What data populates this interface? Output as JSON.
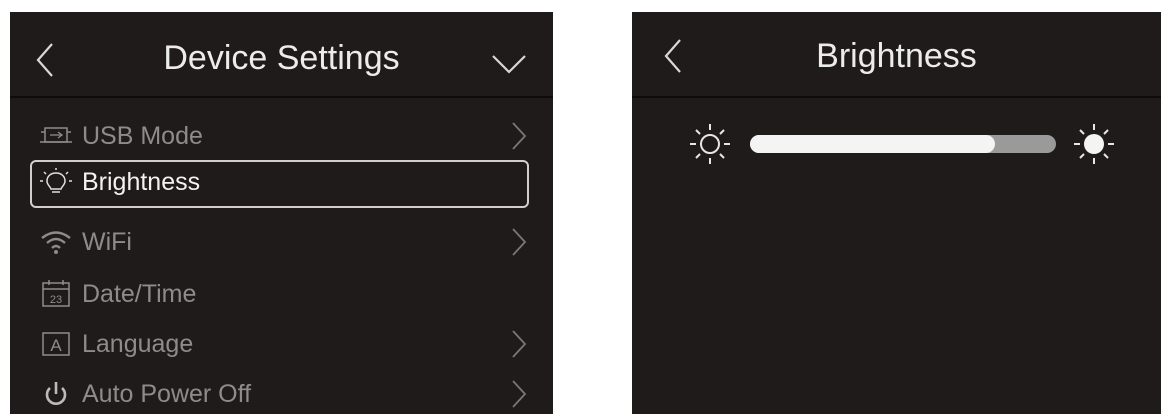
{
  "left_screen": {
    "title": "Device Settings",
    "menu": [
      {
        "label": "USB Mode",
        "icon": "usb-icon",
        "chevron": true,
        "selected": false
      },
      {
        "label": "Brightness",
        "icon": "lightbulb-icon",
        "chevron": false,
        "selected": true
      },
      {
        "label": "WiFi",
        "icon": "wifi-icon",
        "chevron": true,
        "selected": false
      },
      {
        "label": "Date/Time",
        "icon": "calendar-icon",
        "icon_text": "23",
        "chevron": false,
        "selected": false
      },
      {
        "label": "Language",
        "icon": "language-icon",
        "icon_text": "A",
        "chevron": true,
        "selected": false
      },
      {
        "label": "Auto Power Off",
        "icon": "power-icon",
        "chevron": true,
        "selected": false
      }
    ]
  },
  "right_screen": {
    "title": "Brightness",
    "slider": {
      "value_fraction": 0.8
    }
  },
  "colors": {
    "screen_bg": "#1e1b1a",
    "text_primary": "#ececec",
    "text_muted": "#8e8c8a",
    "slider_fill": "#f4f4f4",
    "slider_track": "#9a9a9a"
  }
}
